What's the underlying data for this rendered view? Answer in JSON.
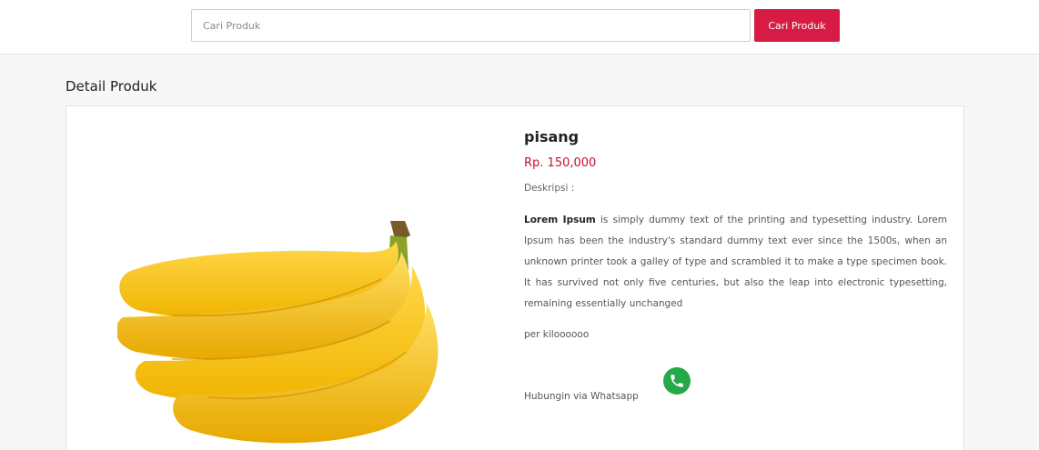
{
  "header": {
    "search_placeholder": "Cari Produk",
    "search_button_label": "Cari Produk",
    "accent_color": "#d81b45"
  },
  "page": {
    "title": "Detail Produk"
  },
  "product": {
    "name": "pisang",
    "price": "Rp. 150,000",
    "description_label": "Deskripsi :",
    "description_lead": "Lorem Ipsum",
    "description_body": " is simply dummy text of the printing and typesetting industry. Lorem Ipsum has been the industry's standard dummy text ever since the 1500s, when an unknown printer took a galley of type and scrambled it to make a type specimen book. It has survived not only five centuries, but also the leap into electronic typesetting, remaining essentially unchanged",
    "unit": "per kiloooooo",
    "image_icon": "banana-image"
  },
  "contact": {
    "label": "Hubungin via Whatsapp",
    "icon": "whatsapp-icon",
    "icon_color": "#25a94a"
  }
}
